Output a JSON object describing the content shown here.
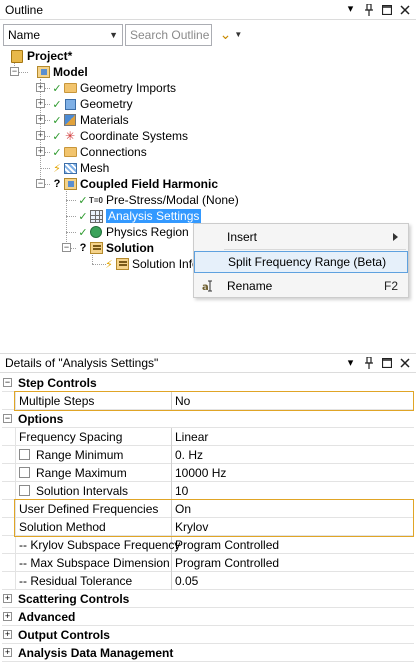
{
  "outline": {
    "title": "Outline",
    "name_select": "Name",
    "search_placeholder": "Search Outline",
    "tree": {
      "project": "Project*",
      "model": "Model",
      "geometry_imports": "Geometry Imports",
      "geometry": "Geometry",
      "materials": "Materials",
      "coordinate_systems": "Coordinate Systems",
      "connections": "Connections",
      "mesh": "Mesh",
      "analysis": "Coupled Field Harmonic",
      "prestress": "Pre-Stress/Modal (None)",
      "analysis_settings": "Analysis Settings",
      "physics_region": "Physics Region",
      "solution": "Solution",
      "solution_info": "Solution Infor",
      "tz_label": "T=0"
    }
  },
  "context_menu": {
    "insert": "Insert",
    "split": "Split Frequency Range (Beta)",
    "rename": "Rename",
    "rename_shortcut": "F2"
  },
  "details": {
    "title": "Details of \"Analysis Settings\"",
    "rows": [
      {
        "type": "group",
        "label": "Step Controls",
        "exp": "−"
      },
      {
        "type": "prop",
        "label": "Multiple Steps",
        "value": "No"
      },
      {
        "type": "group",
        "label": "Options",
        "exp": "−"
      },
      {
        "type": "prop",
        "label": "Frequency Spacing",
        "value": "Linear"
      },
      {
        "type": "prop",
        "label": "Range Minimum",
        "value": "0. Hz",
        "checkbox": true
      },
      {
        "type": "prop",
        "label": "Range Maximum",
        "value": "10000 Hz",
        "checkbox": true
      },
      {
        "type": "prop",
        "label": "Solution Intervals",
        "value": "10",
        "checkbox": true
      },
      {
        "type": "prop",
        "label": "User Defined Frequencies",
        "value": "On"
      },
      {
        "type": "prop",
        "label": "Solution Method",
        "value": "Krylov"
      },
      {
        "type": "prop",
        "label": "-- Krylov Subspace Frequency",
        "value": "Program Controlled"
      },
      {
        "type": "prop",
        "label": "-- Max Subspace Dimension",
        "value": "Program Controlled"
      },
      {
        "type": "prop",
        "label": "-- Residual Tolerance",
        "value": "0.05"
      },
      {
        "type": "group",
        "label": "Scattering Controls",
        "exp": "+"
      },
      {
        "type": "group",
        "label": "Advanced",
        "exp": "+"
      },
      {
        "type": "group",
        "label": "Output Controls",
        "exp": "+"
      },
      {
        "type": "group",
        "label": "Analysis Data Management",
        "exp": "+"
      }
    ]
  },
  "icons": {
    "pin": "pin-icon",
    "dropdown": "dropdown-icon",
    "maximize": "maximize-icon",
    "close": "close-icon"
  }
}
